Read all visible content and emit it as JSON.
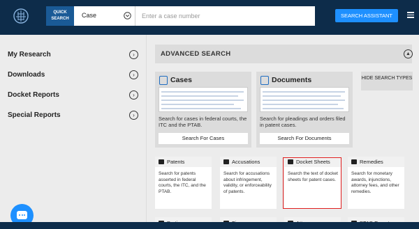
{
  "header": {
    "quick_search_label": "QUICK SEARCH",
    "case_type_value": "Case",
    "search_placeholder": "Enter a case number",
    "search_value": "",
    "assistant_button": "SEARCH ASSISTANT"
  },
  "sidebar": {
    "items": [
      {
        "label": "My Research"
      },
      {
        "label": "Downloads"
      },
      {
        "label": "Docket Reports"
      },
      {
        "label": "Special Reports"
      }
    ]
  },
  "main": {
    "advanced_title": "ADVANCED SEARCH",
    "hide_button": "HIDE SEARCH TYPES",
    "big_cards": [
      {
        "title": "Cases",
        "description": "Search for cases in federal courts, the ITC and the PTAB.",
        "button": "Search For Cases"
      },
      {
        "title": "Documents",
        "description": "Search for pleadings and orders filed in patent cases.",
        "button": "Search For Documents"
      }
    ],
    "small_cards": [
      {
        "title": "Patents",
        "description": "Search for patents asserted in federal courts, the ITC, and the PTAB."
      },
      {
        "title": "Accusations",
        "description": "Search for accusations about infringement, validity, or enforceability of patents."
      },
      {
        "title": "Docket Sheets",
        "description": "Search the text of docket sheets for patent cases."
      },
      {
        "title": "Remedies",
        "description": "Search for monetary awards, injunctions, attorney fees, and other remedies."
      }
    ],
    "bottom_cards": [
      {
        "title": "Parties"
      },
      {
        "title": "Firms"
      },
      {
        "title": "Attorneys"
      },
      {
        "title": "PTAB Experts"
      }
    ]
  },
  "colors": {
    "navy": "#0d2c4a",
    "accent_blue": "#1e90ff",
    "highlight_red": "#e01e1e"
  }
}
